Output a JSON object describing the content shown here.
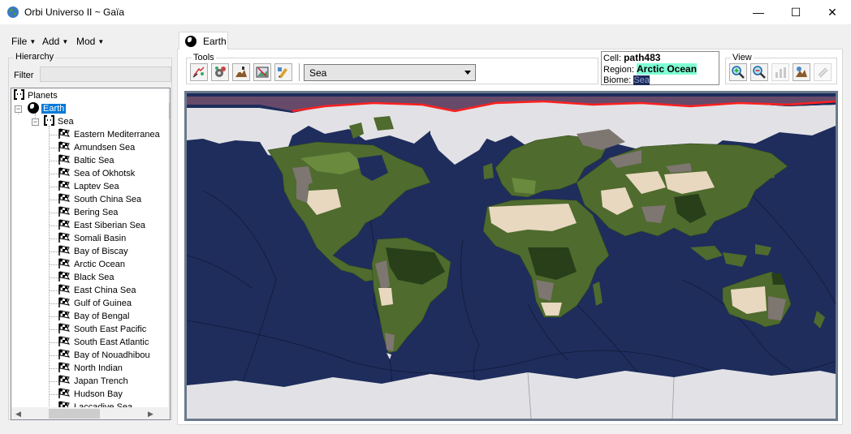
{
  "window": {
    "title": "Orbi Universo II ~ Gaïa",
    "minimize": "—",
    "maximize": "☐",
    "close": "✕"
  },
  "menu": [
    {
      "label": "File"
    },
    {
      "label": "Add"
    },
    {
      "label": "Mod"
    }
  ],
  "hierarchy": {
    "legend": "Hierarchy",
    "filter_label": "Filter",
    "filter_value": "",
    "root": "Planets",
    "planet": "Earth",
    "category": "Sea",
    "items": [
      "Eastern Mediterranea",
      "Amundsen Sea",
      "Baltic Sea",
      "Sea of Okhotsk",
      "Laptev Sea",
      "South China Sea",
      "Bering Sea",
      "East Siberian Sea",
      "Somali Basin",
      "Bay of Biscay",
      "Arctic Ocean",
      "Black Sea",
      "East China Sea",
      "Gulf of Guinea",
      "Bay of Bengal",
      "South East Pacific",
      "South East Atlantic",
      "Bay of Nouadhibou",
      "North Indian",
      "Japan Trench",
      "Hudson Bay",
      "Laccadive Sea"
    ]
  },
  "tab": {
    "label": "Earth"
  },
  "tools": {
    "legend": "Tools",
    "buttons": [
      {
        "icon": "select-cell-icon"
      },
      {
        "icon": "gear-paint-icon"
      },
      {
        "icon": "terrain-tool-icon"
      },
      {
        "icon": "image-tool-icon"
      },
      {
        "icon": "biome-brush-icon"
      }
    ],
    "layer_select": "Sea"
  },
  "info": {
    "cell_label": "Cell:",
    "cell_value": "path483",
    "region_label": "Region:",
    "region_value": "Arctic Ocean",
    "biome_label": "Biome:",
    "biome_value": "Sea"
  },
  "view": {
    "legend": "View",
    "buttons": [
      {
        "icon": "zoom-in-icon",
        "enabled": true
      },
      {
        "icon": "zoom-out-icon",
        "enabled": true
      },
      {
        "icon": "chart-view-icon",
        "enabled": false
      },
      {
        "icon": "globe-view-icon",
        "enabled": true
      },
      {
        "icon": "link-view-icon",
        "enabled": false
      }
    ]
  },
  "colors": {
    "ocean": "#1e2d5c",
    "ice": "#e2e2e6",
    "forest": "#4f6b2e",
    "dense_forest": "#283f1a",
    "desert": "#e8d8c0",
    "mountain": "#7e7671",
    "selection": "#ff2020"
  }
}
